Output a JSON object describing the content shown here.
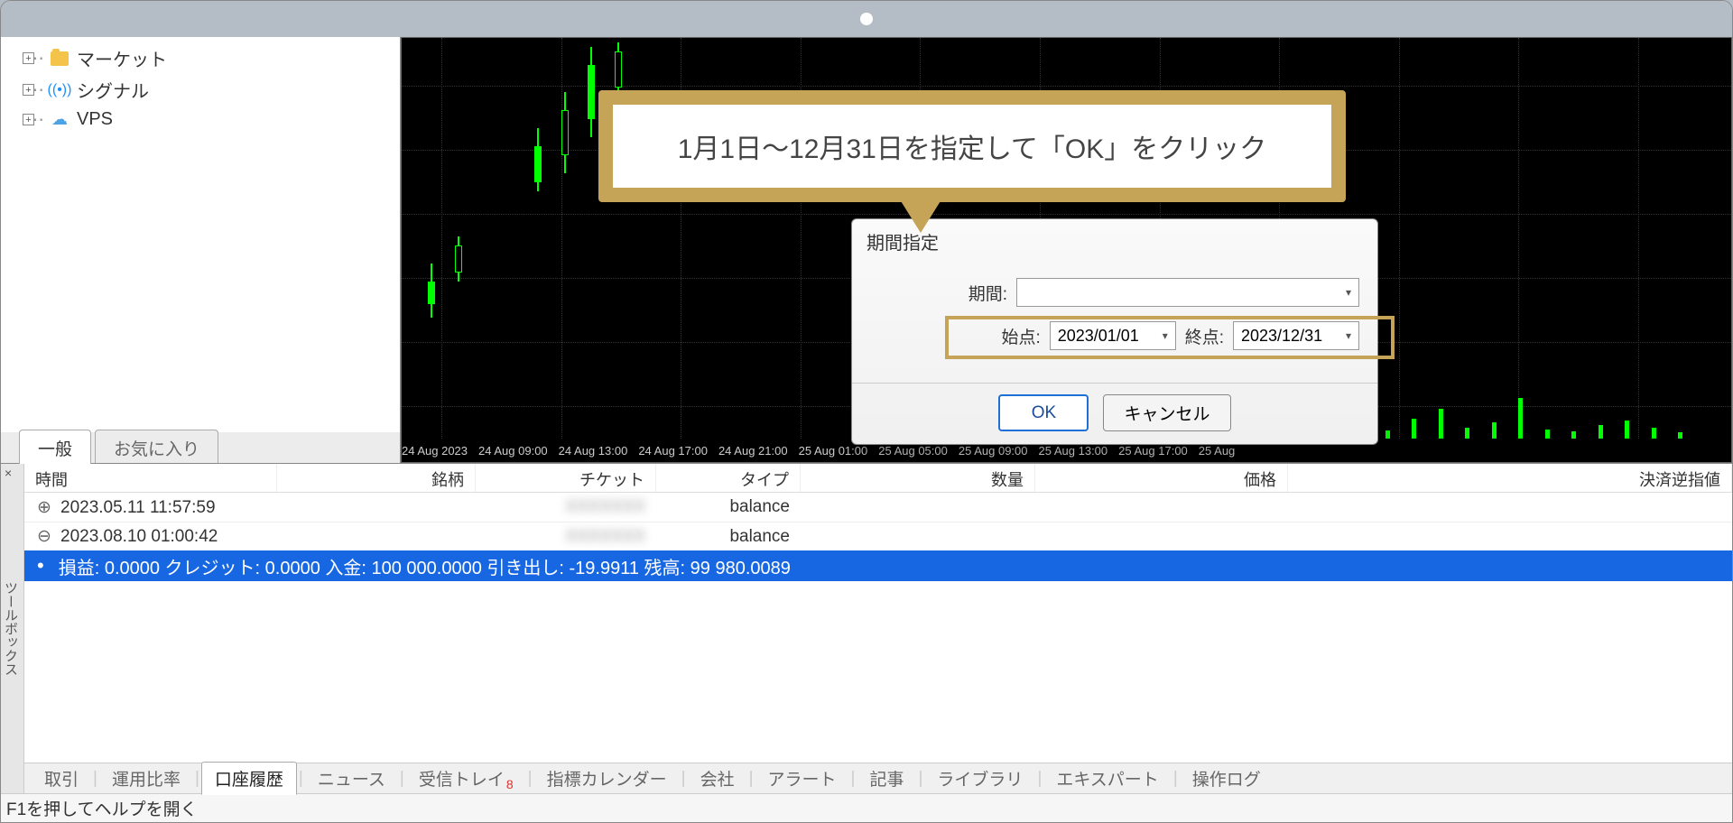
{
  "nav": {
    "tree": [
      {
        "label": "マーケット",
        "icon": "folder"
      },
      {
        "label": "シグナル",
        "icon": "signal"
      },
      {
        "label": "VPS",
        "icon": "cloud"
      }
    ],
    "tabs": {
      "general": "一般",
      "favorites": "お気に入り"
    }
  },
  "chart": {
    "time_ticks": [
      "24 Aug 2023",
      "24 Aug 09:00",
      "24 Aug 13:00",
      "24 Aug 17:00",
      "24 Aug 21:00",
      "25 Aug 01:00",
      "25 Aug 05:00",
      "25 Aug 09:00",
      "25 Aug 13:00",
      "25 Aug 17:00",
      "25 Aug"
    ]
  },
  "dialog": {
    "title": "期間指定",
    "period_label": "期間:",
    "start_label": "始点:",
    "end_label": "終点:",
    "start_value": "2023/01/01",
    "end_value": "2023/12/31",
    "ok": "OK",
    "cancel": "キャンセル"
  },
  "callout": {
    "text": "1月1日〜12月31日を指定して「OK」をクリック"
  },
  "terminal": {
    "panel_label": "ツールボックス",
    "columns": {
      "time": "時間",
      "symbol": "銘柄",
      "ticket": "チケット",
      "type": "タイプ",
      "qty": "数量",
      "price": "価格",
      "sl": "決済逆指値"
    },
    "rows": [
      {
        "icon": "⊕",
        "time": "2023.05.11 11:57:59",
        "ticket": "XXXXXXX",
        "type": "balance"
      },
      {
        "icon": "⊖",
        "time": "2023.08.10 01:00:42",
        "ticket": "XXXXXXX",
        "type": "balance"
      }
    ],
    "summary": "損益: 0.0000  クレジット: 0.0000  入金: 100 000.0000  引き出し: -19.9911  残高: 99 980.0089",
    "tabs": [
      "取引",
      "運用比率",
      "口座履歴",
      "ニュース",
      "受信トレイ",
      "指標カレンダー",
      "会社",
      "アラート",
      "記事",
      "ライブラリ",
      "エキスパート",
      "操作ログ"
    ],
    "active_tab": "口座履歴",
    "inbox_badge": "8"
  },
  "status": "F1を押してヘルプを開く"
}
